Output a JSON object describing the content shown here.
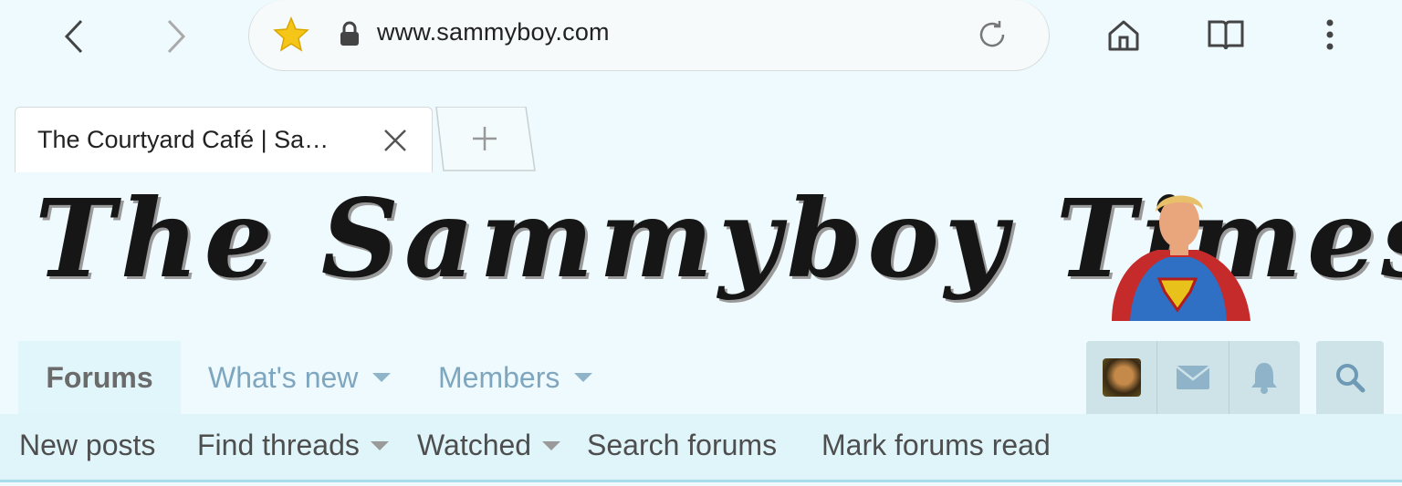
{
  "browser": {
    "url": "www.sammyboy.com",
    "tab_title": "The Courtyard Café | Sa…",
    "icons": [
      "back-icon",
      "forward-icon",
      "star-icon",
      "lock-icon",
      "reload-icon",
      "home-icon",
      "bookmarks-icon",
      "menu-icon"
    ],
    "accent_star": "#f5c518"
  },
  "site": {
    "masthead": "The Sammyboy Times",
    "nav": {
      "forums": "Forums",
      "whats_new": "What's new",
      "members": "Members"
    },
    "subnav": {
      "new_posts": "New posts",
      "find_threads": "Find threads",
      "watched": "Watched",
      "search_forums": "Search forums",
      "mark_read": "Mark forums read"
    },
    "colors": {
      "background": "#eefafd",
      "nav_link": "#7fa6bf",
      "subnav_bg": "#dff5fa",
      "account_bg": "#cde3e8"
    }
  }
}
